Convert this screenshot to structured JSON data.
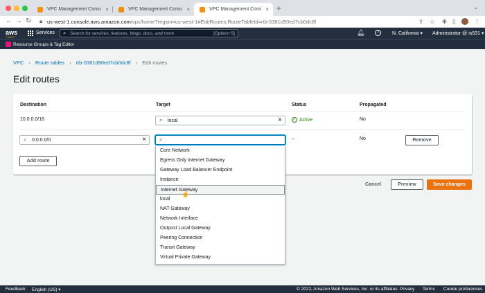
{
  "browser": {
    "tabs": [
      {
        "label": "VPC Management Console",
        "close": "×"
      },
      {
        "label": "VPC Management Console",
        "close": "×"
      },
      {
        "label": "VPC Management Console",
        "close": "×"
      }
    ],
    "new_tab": "+",
    "tab_menu": "⌄",
    "url_host": "us-west-1.console.aws.amazon.com",
    "url_path": "/vpc/home?region=us-west-1#EditRoutes:RouteTableId=rtb-0381d90ed7cb0dc8f",
    "traffic_colors": [
      "#ff5f57",
      "#febc2e",
      "#28c840"
    ]
  },
  "aws_header": {
    "logo": "aws",
    "services_label": "Services",
    "search_placeholder": "Search for services, features, blogs, docs, and more",
    "search_shortcut": "[Option+S]",
    "region": "N. California",
    "account": "Administrator @ is531",
    "resource_groups": "Resource Groups & Tag Editor"
  },
  "breadcrumb": {
    "items": [
      "VPC",
      "Route tables",
      "rtb-0381d90ed7cb0dc8f"
    ],
    "current": "Edit routes"
  },
  "page_title": "Edit routes",
  "table": {
    "headers": [
      "Destination",
      "Target",
      "Status",
      "Propagated"
    ],
    "rows": [
      {
        "destination": "10.0.0.0/16",
        "target": "local",
        "status": "Active",
        "propagated": "No"
      },
      {
        "destination": "0.0.0.0/0",
        "target": "",
        "status": "–",
        "propagated": "No",
        "remove_label": "Remove"
      }
    ]
  },
  "add_route_label": "Add route",
  "target_options": [
    "Core Network",
    "Egress Only Internet Gateway",
    "Gateway Load Balancer Endpoint",
    "Instance",
    "Internet Gateway",
    "local",
    "NAT Gateway",
    "Network Interface",
    "Outpost Local Gateway",
    "Peering Connection",
    "Transit Gateway",
    "Virtual Private Gateway"
  ],
  "highlighted_option": "Internet Gateway",
  "actions": {
    "cancel": "Cancel",
    "preview": "Preview",
    "save": "Save changes"
  },
  "footer": {
    "feedback": "Feedback",
    "language": "English (US) ▾",
    "copyright": "© 2022, Amazon Web Services, Inc. or its affiliates.",
    "privacy": "Privacy",
    "terms": "Terms",
    "cookies": "Cookie preferences"
  },
  "colors": {
    "aws_nav": "#232f3e",
    "link": "#0073bb",
    "primary": "#ec7211",
    "success": "#1d8102"
  }
}
